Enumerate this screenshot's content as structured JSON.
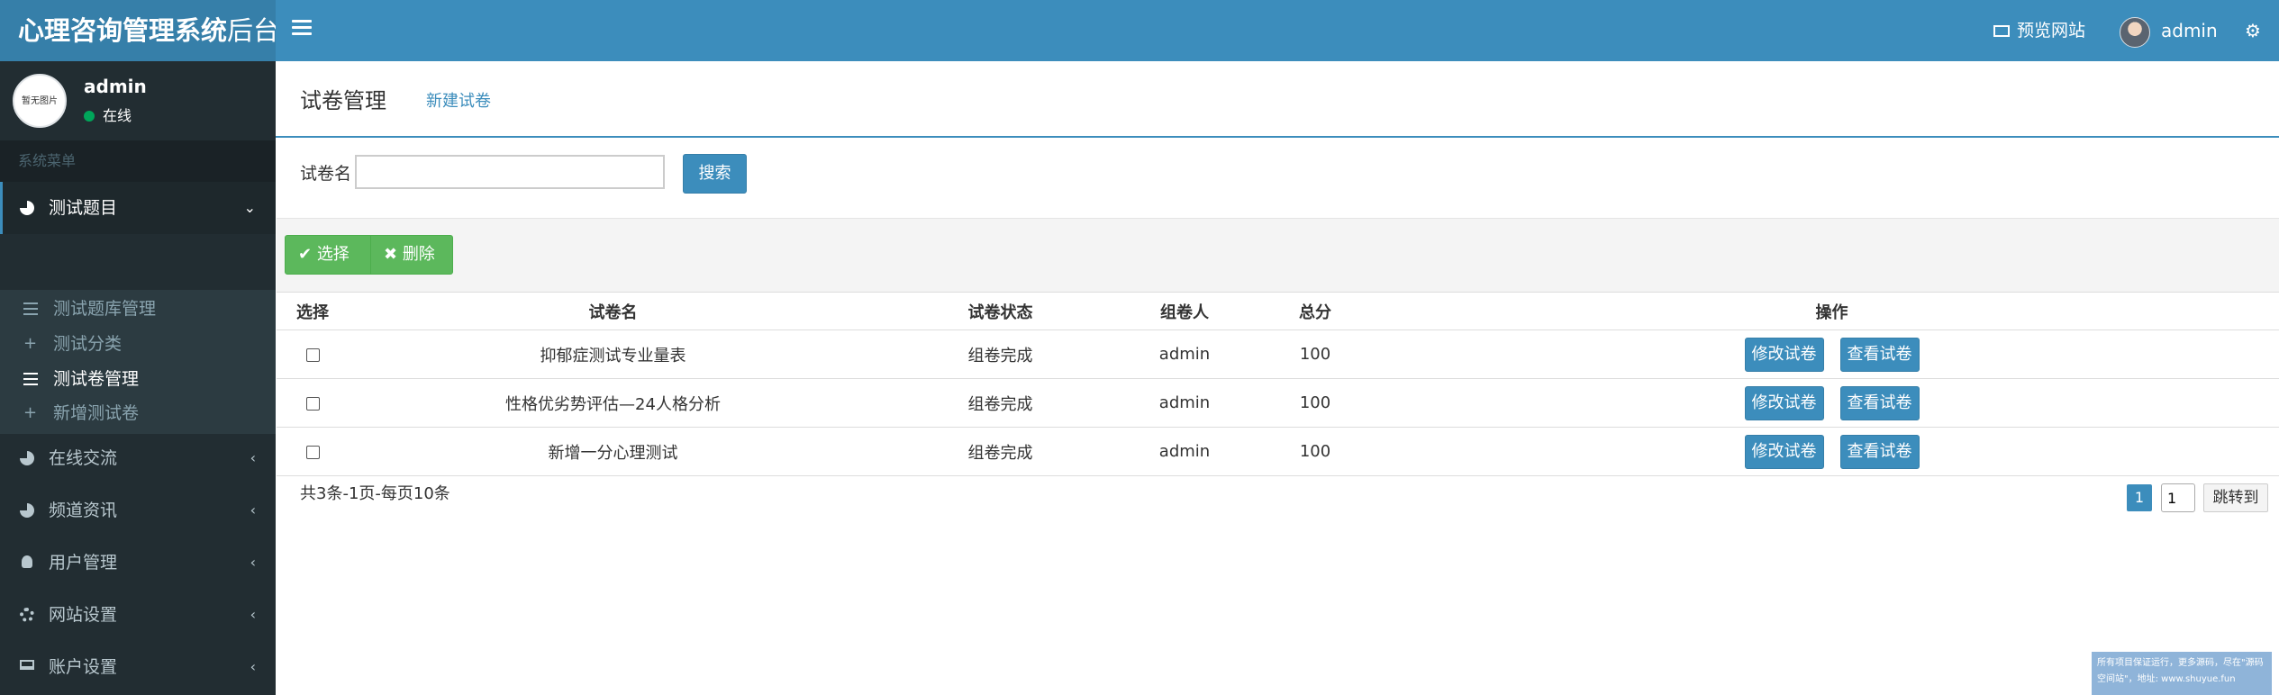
{
  "brand": {
    "title_bold": "心理咨询管理系统",
    "title_light": "后台"
  },
  "topbar": {
    "preview_label": "预览网站",
    "user_name": "admin"
  },
  "sidebar": {
    "avatar_placeholder": "暂无图片",
    "user_name": "admin",
    "status": "在线",
    "menu_header": "系统菜单",
    "items": [
      {
        "label": "测试题目",
        "expanded": true
      },
      {
        "label": "在线交流"
      },
      {
        "label": "频道资讯"
      },
      {
        "label": "用户管理"
      },
      {
        "label": "网站设置"
      },
      {
        "label": "账户设置"
      }
    ],
    "sub_items": [
      {
        "label": "测试题库管理"
      },
      {
        "label": "测试分类"
      },
      {
        "label": "测试卷管理",
        "active": true
      },
      {
        "label": "新增测试卷"
      }
    ]
  },
  "content": {
    "title": "试卷管理",
    "new_link": "新建试卷",
    "search_label": "试卷名",
    "search_value": "",
    "search_button": "搜索",
    "select_button": "选择",
    "delete_button": "删除"
  },
  "table": {
    "headers": [
      "选择",
      "试卷名",
      "试卷状态",
      "组卷人",
      "总分",
      "操作"
    ],
    "rows": [
      {
        "name": "抑郁症测试专业量表",
        "status": "组卷完成",
        "creator": "admin",
        "score": "100",
        "edit": "修改试卷",
        "view": "查看试卷"
      },
      {
        "name": "性格优劣势评估—24人格分析",
        "status": "组卷完成",
        "creator": "admin",
        "score": "100",
        "edit": "修改试卷",
        "view": "查看试卷"
      },
      {
        "name": "新增一分心理测试",
        "status": "组卷完成",
        "creator": "admin",
        "score": "100",
        "edit": "修改试卷",
        "view": "查看试卷"
      }
    ]
  },
  "pagination": {
    "info": "共3条-1页-每页10条",
    "current": "1",
    "input_value": "1",
    "jump_label": "跳转到"
  },
  "notice": {
    "line1": "所有项目保证运行，更多源码，尽在\"源码",
    "line2": "空间站\"，地址: www.shuyue.fun"
  },
  "colors": {
    "primary": "#3c8dbc",
    "sidebar": "#222d32",
    "success": "#5cb85c"
  }
}
